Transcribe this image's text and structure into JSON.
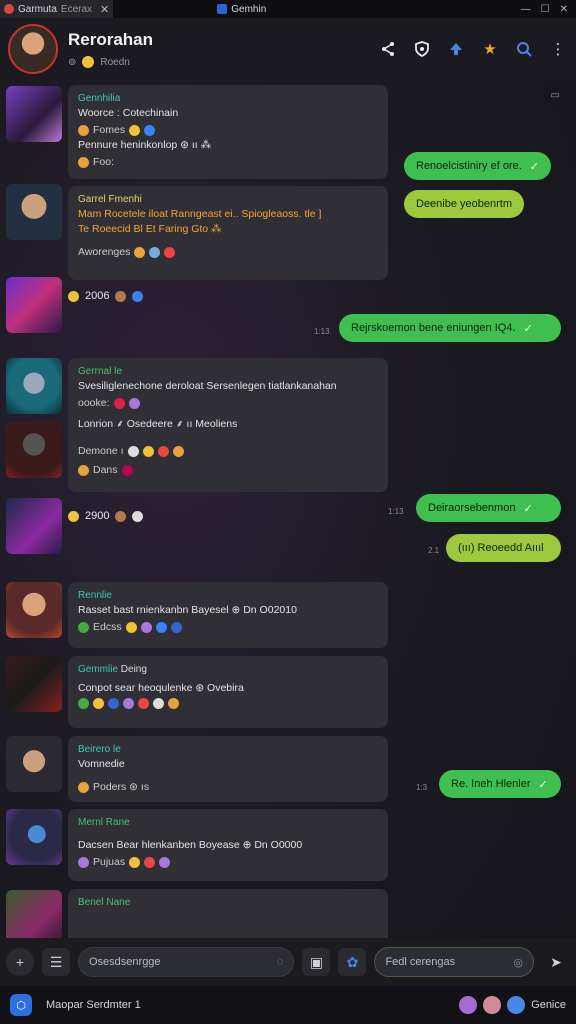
{
  "tabs": [
    {
      "label": "Garmuta",
      "sublabel": "Ecerax",
      "close": "✕"
    },
    {
      "label": "Gemhin"
    }
  ],
  "window_controls": [
    "—",
    "☐",
    "✕"
  ],
  "header": {
    "title": "Rerorahan",
    "subtitle": "Roedn",
    "sub_prefix": "⊚"
  },
  "messages": [
    {
      "name": "Gennhilia",
      "lines": [
        "Woorce : Cotechinain",
        "Pennure heninkonlop ⊛ ıı ⁂"
      ],
      "reacts": "Fomes",
      "extra": "Foo:"
    },
    {
      "name": "Garrel Fmenhi",
      "lines": [
        "Mam Rocetele iloat Ranngeast ei.. Spiogleaoss. tle ]",
        "Te Roeecid  Bl Et  Faring Gto ⁂"
      ],
      "reacts": "Aworenges"
    },
    {
      "name": "Gerrnal le",
      "lines": [
        "Svesiliglenechone deroloat Sersenlegen tiatlankanahan",
        "oooke:",
        "Lonrion ⸙ Osedeere ⸙ ıı  Meoliens"
      ],
      "reacts": "Demone ı",
      "extra": "Dans"
    },
    {
      "name": "Rennlie",
      "lines": [
        "Rasset  bast rnienkanbn  Bayesel  ⊕ Dn O02010"
      ],
      "reacts": "Edcss"
    },
    {
      "name": "Gemmlie",
      "sub": "Deing",
      "lines": [
        "Conpot sear heoqulenke ⊛ Ovebira"
      ]
    },
    {
      "name": "Beirero le",
      "lines": [
        "Vomnedie"
      ],
      "reacts": "Poders  ⊛ ıs"
    },
    {
      "name": "Mernl Rane",
      "lines": [
        "Dacsen Bear hlenkanben  Boyease ⊕ Dn O0000"
      ],
      "reacts": "Pujuas"
    },
    {
      "name": "Benel Nane",
      "lines": [
        ""
      ]
    }
  ],
  "reaction_rows": [
    {
      "label": "2006"
    },
    {
      "label": "2900"
    }
  ],
  "outgoing": [
    {
      "text": "Renoelcistiniry ef ore.",
      "tick": "✓"
    },
    {
      "text": "Deenibe yeobenrtm",
      "tick": ""
    },
    {
      "text": "Rejrskoemon bene eniungen IQ4.",
      "tick": "✓"
    },
    {
      "text": "Deiraorsebenmon",
      "tick": "✓"
    },
    {
      "text": "(ııı) Reoeedd Aıııl",
      "tick": ""
    },
    {
      "text": "Re. Ineh Hlenler",
      "tick": "✓"
    }
  ],
  "timestamps": [
    "1:13",
    "1:13",
    "2.1",
    "1:3"
  ],
  "composer": {
    "add": "+",
    "menu": "☰",
    "placeholder": "Osesdsenrgge",
    "alt_placeholder": "Fedl cerengas",
    "send": "➤"
  },
  "status": {
    "logo": "⬡",
    "text": "Maopar Serdmter 1",
    "right": "Genice"
  },
  "colors": {
    "accent_green": "#3fbf4f",
    "accent_lime": "#9cc93e",
    "name_teal": "#3ec7b8",
    "brand_blue": "#2b6fe0"
  }
}
